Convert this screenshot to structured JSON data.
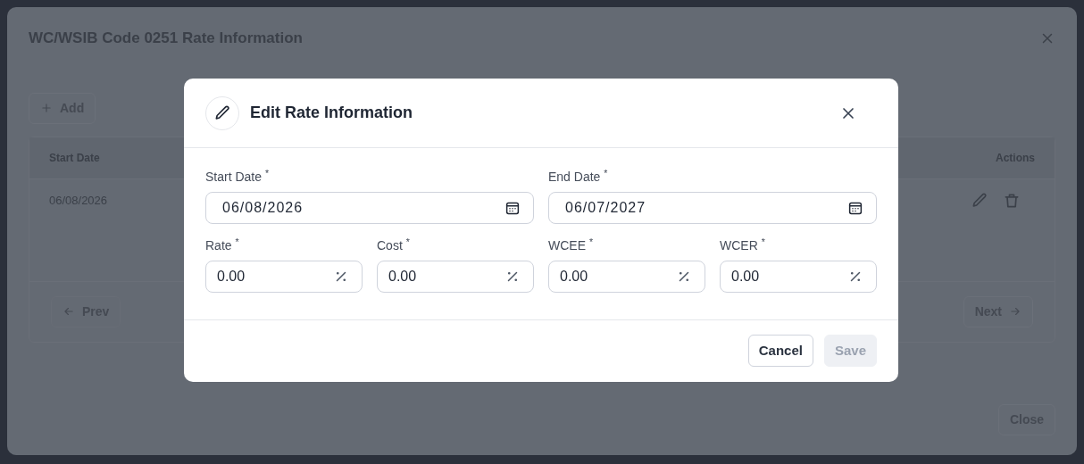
{
  "background_dialog": {
    "title": "WC/WSIB Code 0251 Rate Information",
    "add_button": "Add",
    "table": {
      "columns": [
        "Start Date",
        "Actions"
      ],
      "rows": [
        {
          "start_date": "06/08/2026"
        }
      ]
    },
    "pagination": {
      "prev": "Prev",
      "next": "Next"
    },
    "close_button": "Close"
  },
  "dialog": {
    "title": "Edit Rate Information",
    "field_rows": [
      [
        {
          "label": "Start Date $^{*}$",
          "value": "06/08/2026",
          "kind": "date"
        },
        {
          "label": "End Date $^{*}$",
          "value": "06/07/2027",
          "kind": "date"
        }
      ],
      [
        {
          "label": "Rate $^{*}$",
          "value": "0.00",
          "kind": "percent"
        },
        {
          "label": "Cost $^{*}$",
          "value": "0.00",
          "kind": "percent"
        },
        {
          "label": "WCEE $^{*}$",
          "value": "0.00",
          "kind": "percent"
        },
        {
          "label": "WCER $^{*}$",
          "value": "0.00",
          "kind": "percent"
        }
      ]
    ],
    "buttons": [
      {
        "label": "Cancel",
        "disabled": false
      },
      {
        "label": "Save",
        "disabled": true
      }
    ]
  }
}
